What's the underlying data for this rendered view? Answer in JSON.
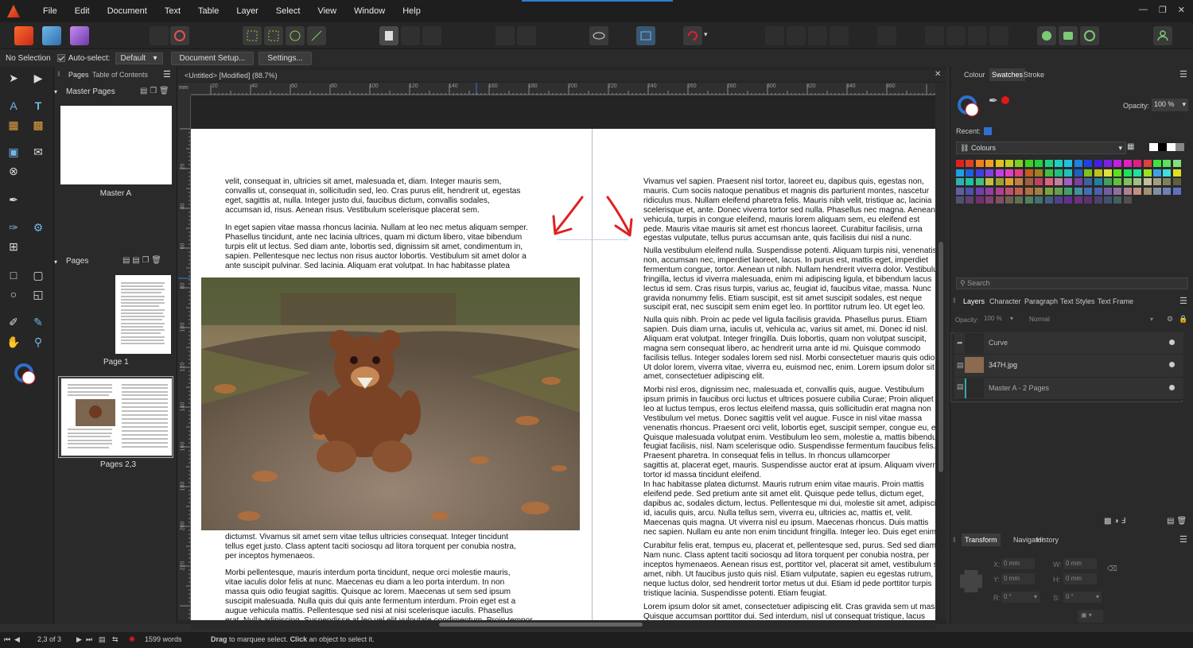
{
  "menu": [
    "File",
    "Edit",
    "Document",
    "Text",
    "Table",
    "Layer",
    "Select",
    "View",
    "Window",
    "Help"
  ],
  "context": {
    "selection": "No Selection",
    "autoselect_label": "Auto-select:",
    "autoselect_value": "Default",
    "doc_setup": "Document Setup...",
    "settings": "Settings..."
  },
  "pages_panel": {
    "tab_pages": "Pages",
    "tab_toc": "Table of Contents",
    "master_header": "Master Pages",
    "master_a": "Master A",
    "pages_header": "Pages",
    "page1": "Page 1",
    "pages23": "Pages 2,3"
  },
  "document": {
    "tab_title": "<Untitled> [Modified] (88.7%)",
    "ruler_units": "mm",
    "h_ticks": [
      "20",
      "40",
      "60",
      "80",
      "100",
      "120",
      "140",
      "160",
      "180",
      "200",
      "220",
      "240",
      "260",
      "280",
      "300",
      "320",
      "340",
      "360"
    ],
    "v_ticks": [
      "20",
      "40",
      "60",
      "80",
      "100",
      "120",
      "140",
      "160",
      "180",
      "200",
      "220"
    ],
    "left_top": "velit, consequat in, ultricies sit amet, malesuada et, diam. Integer mauris sem,\nconvallis ut, consequat in, sollicitudin sed, leo. Cras purus elit, hendrerit ut, egestas\neget, sagittis at, nulla. Integer justo dui, faucibus dictum, convallis sodales,\naccumsan id, risus. Aenean risus. Vestibulum scelerisque placerat sem.",
    "left_p2": "In eget sapien vitae massa rhoncus lacinia. Nullam at leo nec metus aliquam semper.\nPhasellus tincidunt, ante nec lacinia ultrices, quam mi dictum libero, vitae bibendum\nturpis elit ut lectus. Sed diam ante, lobortis sed, dignissim sit amet, condimentum in,\nsapien. Pellentesque nec lectus non risus auctor lobortis. Vestibulum sit amet dolor a\nante suscipit pulvinar. Sed lacinia. Aliquam erat volutpat. In hac habitasse platea",
    "left_p3": "dictumst. Vivamus sit amet sem vitae tellus ultricies consequat. Integer tincidunt\ntellus eget justo. Class aptent taciti sociosqu ad litora torquent per conubia nostra,\nper inceptos hymenaeos.",
    "left_p4": "Morbi pellentesque, mauris interdum porta tincidunt, neque orci molestie mauris,\nvitae iaculis dolor felis at nunc. Maecenas eu diam a leo porta interdum. In non\nmassa quis odio feugiat sagittis. Quisque ac lorem. Maecenas ut sem sed ipsum\nsuscipit malesuada. Nulla quis dui quis ante fermentum interdum. Proin eget est a\naugue vehicula mattis. Pellentesque sed nisi at nisi scelerisque iaculis. Phasellus\nerat. Nulla adipiscing. Suspendisse at leo vel elit vulputate condimentum. Proin tempor",
    "right_p1": "Vivamus vel sapien. Praesent nisl tortor, laoreet eu, dapibus quis, egestas non,\nmauris. Cum sociis natoque penatibus et magnis dis parturient montes, nascetur\nridiculus mus. Nullam eleifend pharetra felis. Mauris nibh velit, tristique ac, lacinia\nscelerisque et, ante. Donec viverra tortor sed nulla. Phasellus nec magna. Aenean\nvehicula, turpis in congue eleifend, mauris lorem aliquam sem, eu eleifend est\npede. Mauris vitae mauris sit amet est rhoncus laoreet. Curabitur facilisis, urna\negestas vulputate, tellus purus accumsan ante, quis facilisis dui nisl a nunc.",
    "right_p2": "Nulla vestibulum eleifend nulla. Suspendisse potenti. Aliquam turpis nisi, venenatis\nnon, accumsan nec, imperdiet laoreet, lacus. In purus est, mattis eget, imperdiet\nfermentum congue, tortor. Aenean ut nibh. Nullam hendrerit viverra dolor. Vestibulum\nfringilla, lectus id viverra malesuada, enim mi adipiscing ligula, et bibendum lacus\nlectus id sem. Cras risus turpis, varius ac, feugiat id, faucibus vitae, massa. Nunc\ngravida nonummy felis. Etiam suscipit, est sit amet suscipit sodales, est neque\nsuscipit erat, nec suscipit sem enim eget leo. In porttitor rutrum leo. Ut eget leo.",
    "right_p3": "Nulla quis nibh. Proin ac pede vel ligula facilisis gravida. Phasellus purus. Etiam\nsapien. Duis diam urna, iaculis ut, vehicula ac, varius sit amet, mi. Donec id nisl.\nAliquam erat volutpat. Integer fringilla. Duis lobortis, quam non volutpat suscipit,\nmagna sem consequat libero, ac hendrerit urna ante id mi. Quisque commodo\nfacilisis tellus. Integer sodales lorem sed nisl. Morbi consectetuer mauris quis odio.\nUt dolor lorem, viverra vitae, viverra eu, euismod nec, enim. Lorem ipsum dolor sit\namet, consectetuer adipiscing elit.",
    "right_p4": "Morbi nisl eros, dignissim nec, malesuada et, convallis quis, augue. Vestibulum\nipsum primis in faucibus orci luctus et ultrices posuere cubilia Curae; Proin aliquet\nleo at luctus tempus, eros lectus eleifend massa, quis sollicitudin erat magna non\nVestibulum vel metus. Donec sagittis velit vel augue. Fusce in nisl vitae massa\nvenenatis rhoncus. Praesent orci velit, lobortis eget, suscipit semper, congue eu, est.\nQuisque malesuada volutpat enim. Vestibulum leo sem, molestie a, mattis bibendum,\nfeugiat facilisis, nisl. Nam scelerisque odio. Suspendisse fermentum faucibus felis.\nPraesent pharetra. In consequat felis in tellus. In rhoncus ullamcorper\nsagittis at, placerat eget, mauris. Suspendisse auctor erat at ipsum. Aliquam viverra\ntortor id massa tincidunt eleifend.",
    "right_p5": "In hac habitasse platea dictumst. Mauris rutrum enim vitae mauris. Proin mattis\neleifend pede. Sed pretium ante sit amet elit. Quisque pede tellus, dictum eget,\ndapibus ac, sodales dictum, lectus. Pellentesque mi dui, molestie sit amet, adipiscing\nid, iaculis quis, arcu. Nulla tellus sem, viverra eu, ultricies ac, mattis et, velit.\nMaecenas quis magna. Ut viverra nisl eu ipsum. Maecenas rhoncus. Duis mattis\nnec sapien. Nullam eu ante non enim tincidunt fringilla. Integer leo. Duis eget enim.",
    "right_p6": "Curabitur felis erat, tempus eu, placerat et, pellentesque sed, purus. Sed sed diam.\nNam nunc. Class aptent taciti sociosqu ad litora torquent per conubia nostra, per\ninceptos hymenaeos. Aenean risus est, porttitor vel, placerat sit amet, vestibulum sit\namet, nibh. Ut faucibus justo quis nisl. Etiam vulputate, sapien eu egestas rutrum,\nneque luctus dolor, sed hendrerit tortor metus ut dui. Etiam id pede porttitor turpis\ntristique lacinia. Suspendisse potenti. Etiam feugiat.",
    "right_p7": "Lorem ipsum dolor sit amet, consectetuer adipiscing elit. Cras gravida sem ut massa.\nQuisque accumsan porttitor dui. Sed interdum, nisl ut consequat tristique, lacus"
  },
  "right_panel": {
    "tabs_top": [
      "Colour",
      "Swatches",
      "Stroke"
    ],
    "opacity_label": "Opacity:",
    "opacity_value": "100 %",
    "recent_label": "Recent:",
    "palette_name": "Colours",
    "search_placeholder": "Search",
    "tabs_mid": [
      "Layers",
      "Character",
      "Paragraph",
      "Text Styles",
      "Text Frame"
    ],
    "layer_opacity_label": "Opacity:",
    "layer_opacity": "100 %",
    "blend_mode": "Normal",
    "layers": [
      "Curve",
      "347H.jpg",
      "Master A - 2 Pages"
    ],
    "tabs_bottom": [
      "Transform",
      "Navigator",
      "History"
    ],
    "transform": {
      "x_label": "X:",
      "x": "0 mm",
      "y_label": "Y:",
      "y": "0 mm",
      "w_label": "W:",
      "w": "0 mm",
      "h_label": "H:",
      "h": "0 mm",
      "r_label": "R:",
      "r": "0 °",
      "s_label": "S:",
      "s": "0 °"
    }
  },
  "status": {
    "page": "2,3 of 3",
    "words": "1599 words",
    "hint_drag": "Drag",
    "hint_mid": " to marquee select. ",
    "hint_click": "Click",
    "hint_end": " an object to select it."
  },
  "colors": {
    "accent": "#2f7fd0",
    "arrow": "#e02020",
    "panel": "#2a2a2a",
    "menubar": "#1e1e1e"
  }
}
